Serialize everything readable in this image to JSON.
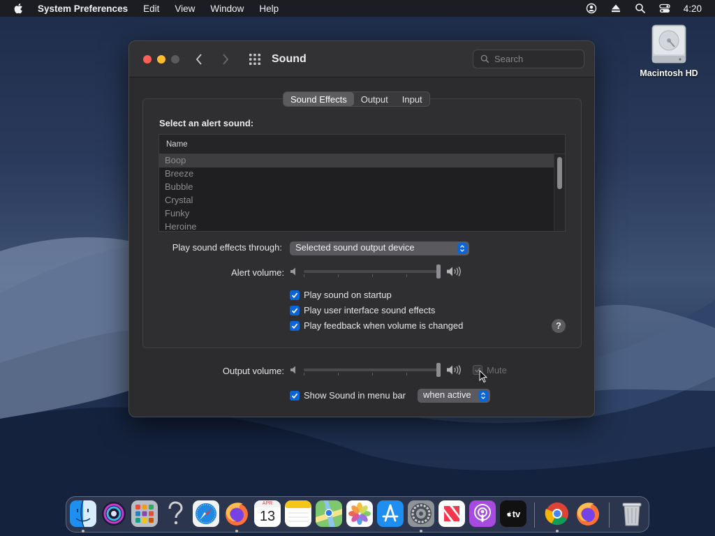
{
  "menubar": {
    "app_name": "System Preferences",
    "menus": [
      "Edit",
      "View",
      "Window",
      "Help"
    ],
    "clock": "4:20",
    "icons": [
      "user-icon",
      "eject-icon",
      "search-icon",
      "control-center-icon"
    ]
  },
  "desktop": {
    "drive_label": "Macintosh HD"
  },
  "window": {
    "title": "Sound",
    "search_placeholder": "Search",
    "tabs": [
      {
        "label": "Sound Effects",
        "active": true
      },
      {
        "label": "Output",
        "active": false
      },
      {
        "label": "Input",
        "active": false
      }
    ],
    "alert_label": "Select an alert sound:",
    "list_header": "Name",
    "sounds": [
      "Boop",
      "Breeze",
      "Bubble",
      "Crystal",
      "Funky",
      "Heroine"
    ],
    "selected_sound": "Boop",
    "play_through_label": "Play sound effects through:",
    "play_through_value": "Selected sound output device",
    "alert_volume_label": "Alert volume:",
    "alert_volume_level": 1.0,
    "checkboxes": [
      {
        "label": "Play sound on startup",
        "checked": true
      },
      {
        "label": "Play user interface sound effects",
        "checked": true
      },
      {
        "label": "Play feedback when volume is changed",
        "checked": true
      }
    ],
    "help_label": "?",
    "output_volume_label": "Output volume:",
    "output_volume_level": 1.0,
    "mute_label": "Mute",
    "mute_checked": false,
    "show_in_menubar_label": "Show Sound in menu bar",
    "show_in_menubar_checked": true,
    "menubar_mode_value": "when active"
  },
  "dock": {
    "calendar_month": "APR",
    "calendar_day": "13",
    "tv_label": "tv",
    "apps": [
      "Finder",
      "Siri",
      "Launchpad",
      "Help",
      "Safari",
      "Firefox",
      "Calendar",
      "Notes",
      "Maps",
      "Photos",
      "App Store",
      "System Preferences",
      "News",
      "Podcasts",
      "TV",
      "Chrome",
      "Firefox",
      "Trash"
    ]
  },
  "colors": {
    "accent": "#0a66d8",
    "window_bg": "#2c2c2e",
    "close": "#ff5f57",
    "minimize": "#febc2e"
  }
}
